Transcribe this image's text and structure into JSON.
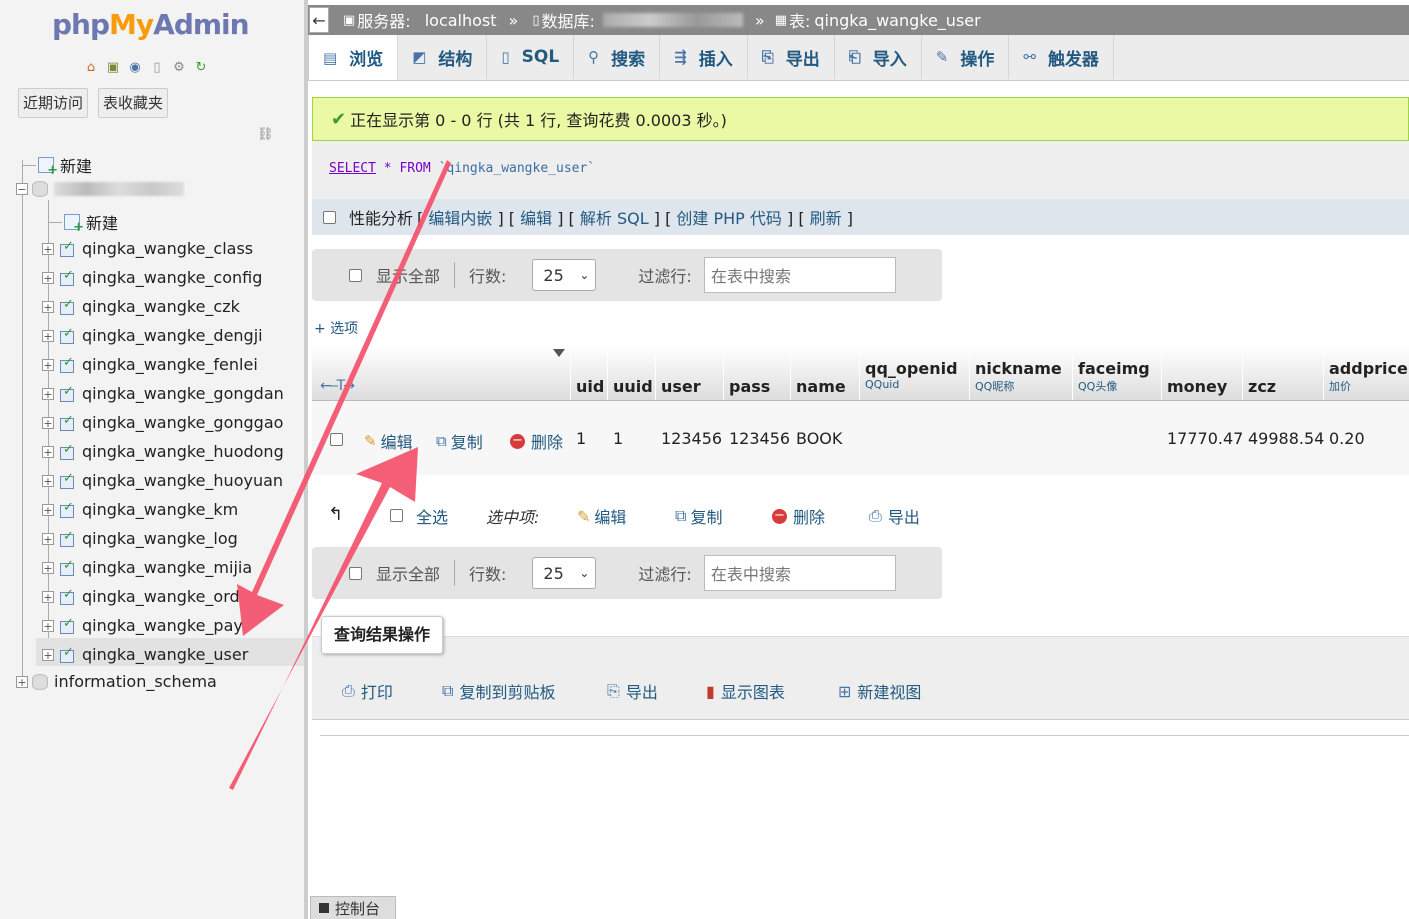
{
  "nav": {
    "logo_php": "php",
    "logo_my": "My",
    "logo_admin": "Admin",
    "icons": [
      "home-icon",
      "exit-icon",
      "help-icon",
      "docs-icon",
      "settings-icon",
      "reload-icon"
    ],
    "recent_label": "近期访问",
    "favorites_label": "表收藏夹",
    "new_label": "新建",
    "db_new_label": "新建",
    "tables": [
      "qingka_wangke_class",
      "qingka_wangke_config",
      "qingka_wangke_czk",
      "qingka_wangke_dengji",
      "qingka_wangke_fenlei",
      "qingka_wangke_gongdan",
      "qingka_wangke_gonggao",
      "qingka_wangke_huodong",
      "qingka_wangke_huoyuan",
      "qingka_wangke_km",
      "qingka_wangke_log",
      "qingka_wangke_mijia",
      "qingka_wangke_ord",
      "qingka_wangke_pay",
      "qingka_wangke_user"
    ],
    "other_db": "information_schema"
  },
  "breadcrumb": {
    "server_label": "服务器:",
    "server_value": "localhost",
    "sep": "»",
    "db_label": "数据库:",
    "table_label": "表:",
    "table_value": "qingka_wangke_user"
  },
  "tabs": [
    {
      "label": "浏览",
      "icon": "browse-icon"
    },
    {
      "label": "结构",
      "icon": "structure-icon"
    },
    {
      "label": "SQL",
      "icon": "sql-icon"
    },
    {
      "label": "搜索",
      "icon": "search-icon"
    },
    {
      "label": "插入",
      "icon": "insert-icon"
    },
    {
      "label": "导出",
      "icon": "export-icon"
    },
    {
      "label": "导入",
      "icon": "import-icon"
    },
    {
      "label": "操作",
      "icon": "wrench-icon"
    },
    {
      "label": "触发器",
      "icon": "trigger-icon"
    }
  ],
  "message": "正在显示第 0 - 0 行 (共 1 行, 查询花费 0.0003 秒。)",
  "sql": {
    "select": "SELECT",
    "star": "*",
    "from": "FROM",
    "table": "`qingka_wangke_user`"
  },
  "perf": {
    "label": "性能分析",
    "links": [
      "编辑内嵌",
      "编辑",
      "解析 SQL",
      "创建 PHP 代码",
      "刷新"
    ]
  },
  "navbox": {
    "show_all": "显示全部",
    "rows_label": "行数:",
    "rows_value": "25",
    "filter_label": "过滤行:",
    "filter_placeholder": "在表中搜索"
  },
  "options_link": "+ 选项",
  "columns": [
    {
      "name": "uid",
      "comment": ""
    },
    {
      "name": "uuid",
      "comment": ""
    },
    {
      "name": "user",
      "comment": ""
    },
    {
      "name": "pass",
      "comment": ""
    },
    {
      "name": "name",
      "comment": ""
    },
    {
      "name": "qq_openid",
      "comment": "QQuid"
    },
    {
      "name": "nickname",
      "comment": "QQ昵称"
    },
    {
      "name": "faceimg",
      "comment": "QQ头像"
    },
    {
      "name": "money",
      "comment": ""
    },
    {
      "name": "zcz",
      "comment": ""
    },
    {
      "name": "addprice",
      "comment": "加价"
    }
  ],
  "row": {
    "edit": "编辑",
    "copy": "复制",
    "delete": "删除",
    "uid": "1",
    "uuid": "1",
    "user": "123456",
    "pass": "123456",
    "name": "BOOK",
    "qq_openid": "",
    "nickname": "",
    "faceimg": "",
    "money": "17770.47",
    "zcz": "49988.54",
    "addprice": "0.20"
  },
  "with_selected": {
    "check_all": "全选",
    "label": "选中项:",
    "edit": "编辑",
    "copy": "复制",
    "delete": "删除",
    "export": "导出"
  },
  "result_ops": {
    "legend": "查询结果操作",
    "items": [
      "打印",
      "复制到剪贴板",
      "导出",
      "显示图表",
      "新建视图"
    ]
  },
  "console_label": "控制台",
  "colors": {
    "annotation_arrow": "#f4506b",
    "link": "#235a81",
    "success_bg": "#ebf8a4"
  }
}
